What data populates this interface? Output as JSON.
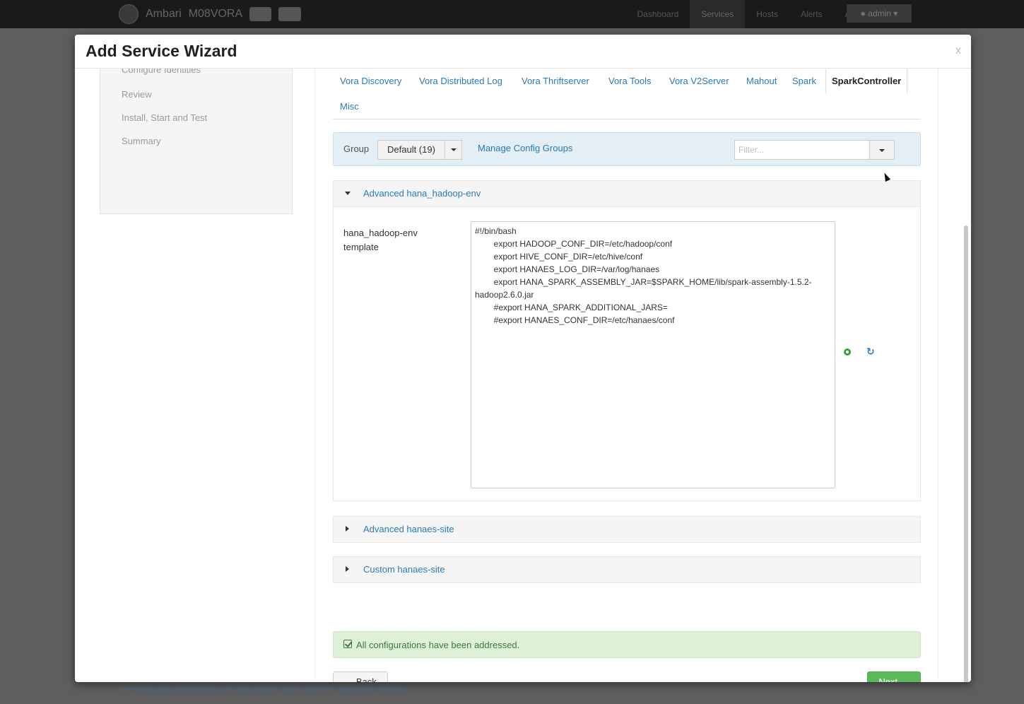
{
  "app": {
    "brand": "Ambari",
    "cluster": "M08VORA",
    "badges": [
      "",
      ""
    ],
    "nav": [
      "Dashboard",
      "Services",
      "Hosts",
      "Alerts",
      "Admin"
    ],
    "user": "admin",
    "footer": "See third-party tools/resources that Ambari uses and their respective authors"
  },
  "modal": {
    "title": "Add Service Wizard",
    "close": "x"
  },
  "wizard": {
    "steps": [
      "Configure Identities",
      "Review",
      "Install, Start and Test",
      "Summary"
    ]
  },
  "tabs": {
    "items": [
      "Vora Discovery",
      "Vora Distributed Log",
      "Vora Thriftserver",
      "Vora Tools",
      "Vora V2Server",
      "Mahout",
      "Spark",
      "SparkController",
      "Misc"
    ],
    "active": "SparkController"
  },
  "toolbar": {
    "group_label": "Group",
    "group_value": "Default (19)",
    "manage_link": "Manage Config Groups",
    "filter_placeholder": "Filter..."
  },
  "sections": [
    {
      "title": "Advanced hana_hadoop-env",
      "expanded": true,
      "property_label": "hana_hadoop-env template",
      "property_value": "#!/bin/bash\n        export HADOOP_CONF_DIR=/etc/hadoop/conf\n        export HIVE_CONF_DIR=/etc/hive/conf\n        export HANAES_LOG_DIR=/var/log/hanaes\n        export HANA_SPARK_ASSEMBLY_JAR=$SPARK_HOME/lib/spark-assembly-1.5.2-hadoop2.6.0.jar\n        #export HANA_SPARK_ADDITIONAL_JARS=\n        #export HANAES_CONF_DIR=/etc/hanaes/conf"
    },
    {
      "title": "Advanced hanaes-site",
      "expanded": false
    },
    {
      "title": "Custom hanaes-site",
      "expanded": false
    }
  ],
  "alert": {
    "message": "All configurations have been addressed."
  },
  "buttons": {
    "back": "← Back",
    "next": "Next →"
  },
  "colors": {
    "link": "#2a7ab8",
    "success_bg": "#dff0d8",
    "primary_green": "#5cb85c",
    "toolbar_bg": "#e3eef5"
  },
  "icons": {
    "add_override": "plus-circle-icon",
    "undo": "undo-icon",
    "alert": "check-square-icon"
  }
}
